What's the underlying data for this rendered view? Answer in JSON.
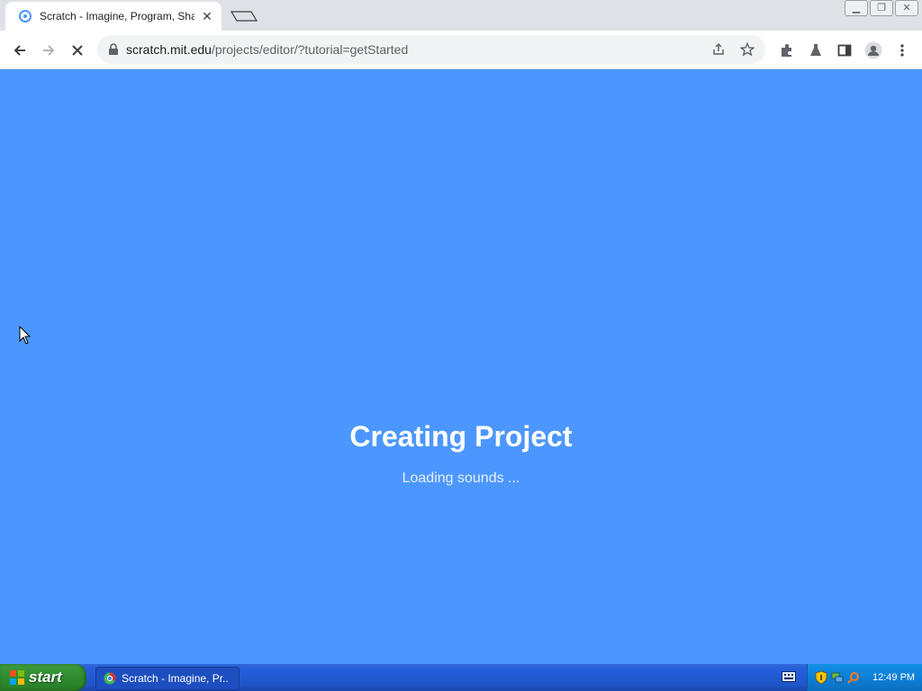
{
  "browser": {
    "tab": {
      "title": "Scratch - Imagine, Program, Share",
      "favicon": "scratch-favicon"
    },
    "url": {
      "host": "scratch.mit.edu",
      "path": "/projects/editor/?tutorial=getStarted"
    }
  },
  "loader": {
    "title": "Creating Project",
    "message": "Loading sounds ..."
  },
  "taskbar": {
    "start_label": "start",
    "task_title": "Scratch - Imagine, Pr...",
    "clock": "12:49 PM"
  },
  "colors": {
    "content_bg": "#4c97ff",
    "taskbar_bg": "#245edb",
    "start_green": "#2f8b2f"
  }
}
